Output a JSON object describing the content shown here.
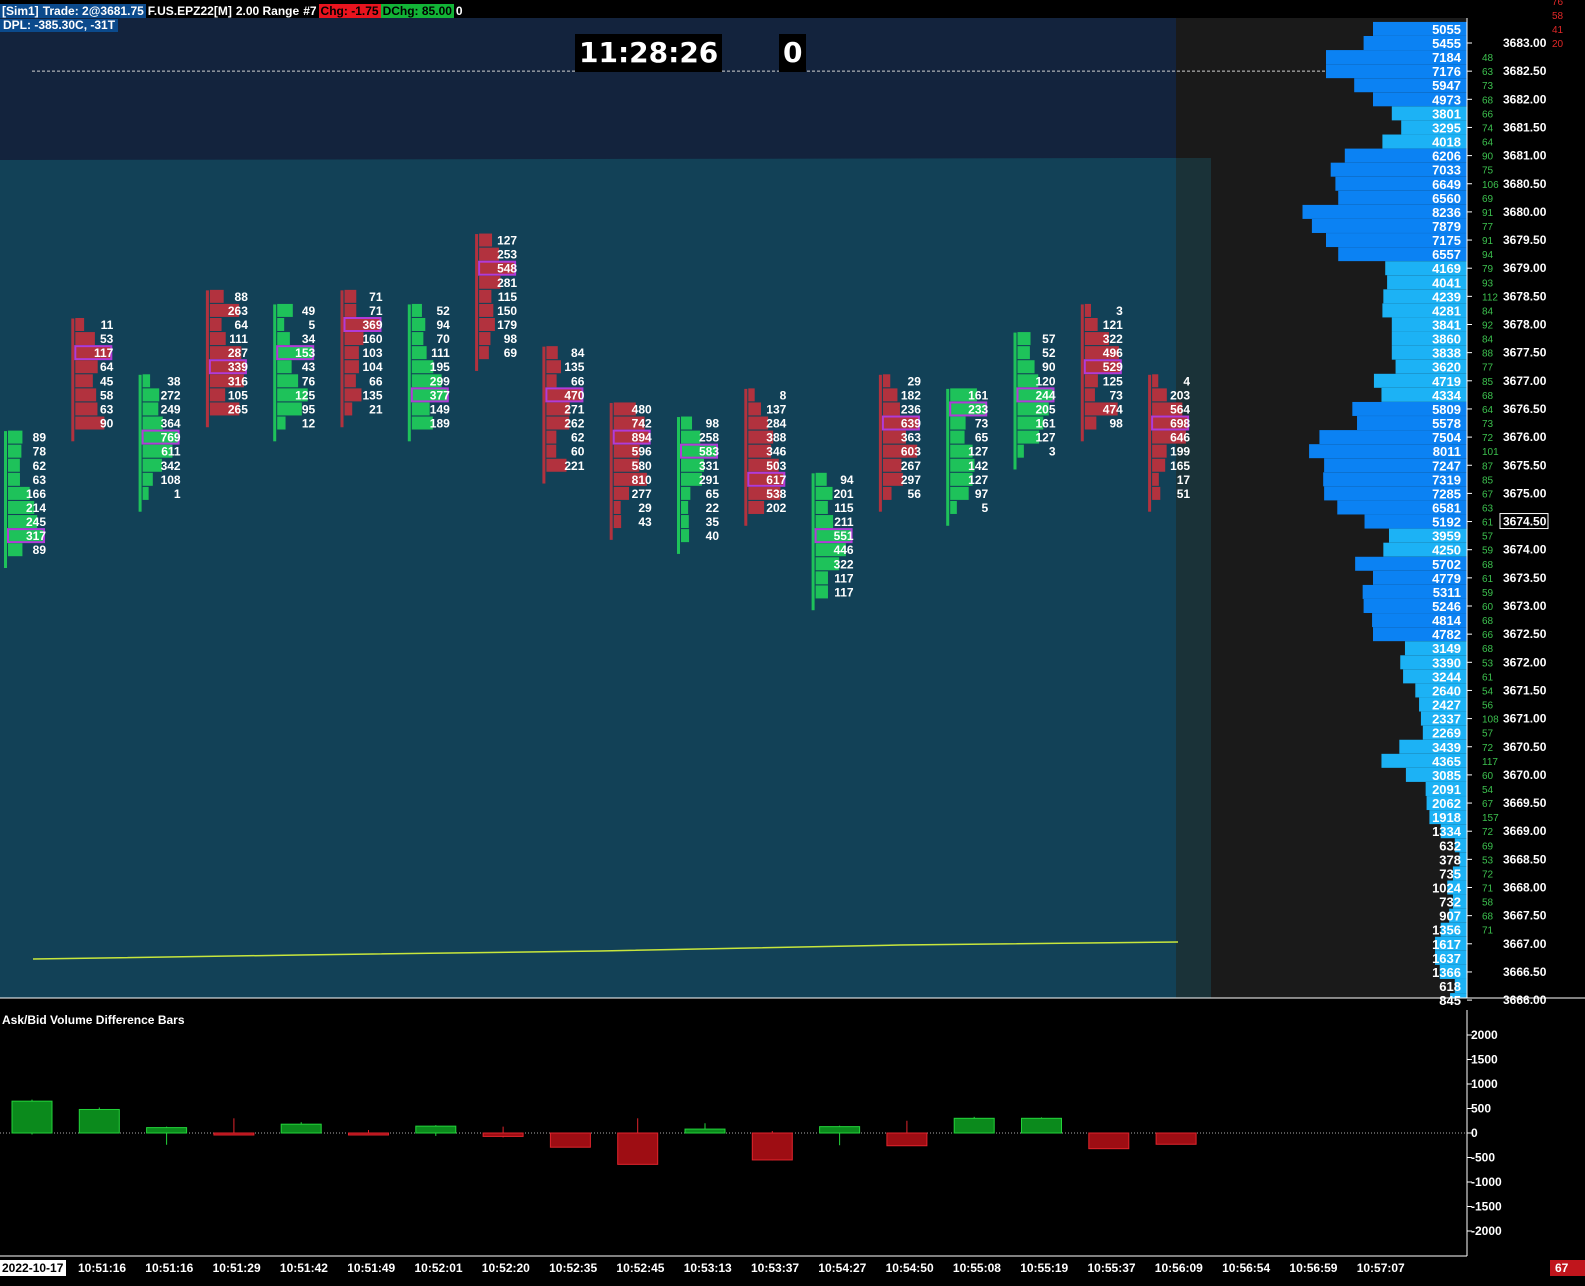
{
  "header": {
    "account": "[Sim1]",
    "trade": "Trade: 2@3681.75",
    "symbol": "F.US.EPZ22[M]",
    "bar_type": "2.00 Range",
    "bar_num": "#7",
    "chg": "Chg: -1.75",
    "dchg": "DChg: 85.00",
    "extra": "0",
    "dpl": "DPL: -385.30C, -31T"
  },
  "clock": {
    "time": "11:28:26",
    "counter": "0"
  },
  "colors": {
    "ask_green": "#1ec25a",
    "bid_red": "#b2323e",
    "poc_outline": "#b13bd8",
    "profile_blue": "#0b82f3",
    "profile_light": "#1cb2f5",
    "vwap": "#c8e63c",
    "bg_upper": "#13233d",
    "bg_lower": "#124157"
  },
  "price_axis": {
    "labels": [
      "3683.00",
      "3682.50",
      "3682.00",
      "3681.50",
      "3681.00",
      "3680.50",
      "3680.00",
      "3679.50",
      "3679.00",
      "3678.50",
      "3678.00",
      "3677.50",
      "3677.00",
      "3676.50",
      "3676.00",
      "3675.50",
      "3675.00",
      "3674.50",
      "3674.00",
      "3673.50",
      "3673.00",
      "3672.50",
      "3672.00",
      "3671.50",
      "3671.00",
      "3670.50",
      "3670.00",
      "3669.50",
      "3669.00",
      "3668.50",
      "3668.00",
      "3667.50",
      "3667.00",
      "3666.50",
      "3666.00"
    ],
    "current": "3674.50"
  },
  "right_small": [
    "76",
    "58",
    "41",
    "20",
    "48",
    "63",
    "73",
    "68",
    "66",
    "74",
    "64",
    "90",
    "75",
    "106",
    "69",
    "91",
    "77",
    "91",
    "94",
    "79",
    "93",
    "112",
    "84",
    "92",
    "84",
    "88",
    "77",
    "85",
    "68",
    "64",
    "73",
    "72",
    "101",
    "87",
    "85",
    "67",
    "63",
    "61",
    "57",
    "59",
    "68",
    "61",
    "59",
    "60",
    "68",
    "66",
    "68",
    "53",
    "61",
    "54",
    "56",
    "108",
    "57",
    "72",
    "117",
    "60",
    "54",
    "67",
    "157",
    "72",
    "69",
    "53",
    "72",
    "71",
    "58",
    "68",
    "71"
  ],
  "profile": [
    {
      "p": 3683.25,
      "v": "5055",
      "w": 1.0
    },
    {
      "p": 3683.0,
      "v": "5455",
      "w": 1.1
    },
    {
      "p": 3682.75,
      "v": "7184",
      "w": 1.5
    },
    {
      "p": 3682.5,
      "v": "7176",
      "w": 1.5
    },
    {
      "p": 3682.25,
      "v": "5947",
      "w": 1.2
    },
    {
      "p": 3682.0,
      "v": "4973",
      "w": 1.0
    },
    {
      "p": 3681.75,
      "v": "3801",
      "w": 0.8
    },
    {
      "p": 3681.5,
      "v": "3295",
      "w": 0.7
    },
    {
      "p": 3681.25,
      "v": "4018",
      "w": 0.9
    },
    {
      "p": 3681.0,
      "v": "6206",
      "w": 1.3
    },
    {
      "p": 3680.75,
      "v": "7033",
      "w": 1.45
    },
    {
      "p": 3680.5,
      "v": "6649",
      "w": 1.4
    },
    {
      "p": 3680.25,
      "v": "6560",
      "w": 1.37
    },
    {
      "p": 3680.0,
      "v": "8236",
      "w": 1.75
    },
    {
      "p": 3679.75,
      "v": "7879",
      "w": 1.65
    },
    {
      "p": 3679.5,
      "v": "7175",
      "w": 1.5
    },
    {
      "p": 3679.25,
      "v": "6557",
      "w": 1.37
    },
    {
      "p": 3679.0,
      "v": "4169",
      "w": 0.87
    },
    {
      "p": 3678.75,
      "v": "4041",
      "w": 0.85
    },
    {
      "p": 3678.5,
      "v": "4239",
      "w": 0.89
    },
    {
      "p": 3678.25,
      "v": "4281",
      "w": 0.9
    },
    {
      "p": 3678.0,
      "v": "3841",
      "w": 0.8
    },
    {
      "p": 3677.75,
      "v": "3860",
      "w": 0.8
    },
    {
      "p": 3677.5,
      "v": "3838",
      "w": 0.8
    },
    {
      "p": 3677.25,
      "v": "3620",
      "w": 0.76
    },
    {
      "p": 3677.0,
      "v": "4719",
      "w": 0.99
    },
    {
      "p": 3676.75,
      "v": "4334",
      "w": 0.91
    },
    {
      "p": 3676.5,
      "v": "5809",
      "w": 1.22
    },
    {
      "p": 3676.25,
      "v": "5578",
      "w": 1.17
    },
    {
      "p": 3676.0,
      "v": "7504",
      "w": 1.57
    },
    {
      "p": 3675.75,
      "v": "8011",
      "w": 1.68
    },
    {
      "p": 3675.5,
      "v": "7247",
      "w": 1.52
    },
    {
      "p": 3675.25,
      "v": "7319",
      "w": 1.53
    },
    {
      "p": 3675.0,
      "v": "7285",
      "w": 1.52
    },
    {
      "p": 3674.75,
      "v": "6581",
      "w": 1.38
    },
    {
      "p": 3674.5,
      "v": "5192",
      "w": 1.09
    },
    {
      "p": 3674.25,
      "v": "3959",
      "w": 0.83
    },
    {
      "p": 3674.0,
      "v": "4250",
      "w": 0.89
    },
    {
      "p": 3673.75,
      "v": "5702",
      "w": 1.19
    },
    {
      "p": 3673.5,
      "v": "4779",
      "w": 1.0
    },
    {
      "p": 3673.25,
      "v": "5311",
      "w": 1.11
    },
    {
      "p": 3673.0,
      "v": "5246",
      "w": 1.1
    },
    {
      "p": 3672.75,
      "v": "4814",
      "w": 1.01
    },
    {
      "p": 3672.5,
      "v": "4782",
      "w": 1.0
    },
    {
      "p": 3672.25,
      "v": "3149",
      "w": 0.66
    },
    {
      "p": 3672.0,
      "v": "3390",
      "w": 0.71
    },
    {
      "p": 3671.75,
      "v": "3244",
      "w": 0.68
    },
    {
      "p": 3671.5,
      "v": "2640",
      "w": 0.55
    },
    {
      "p": 3671.25,
      "v": "2427",
      "w": 0.51
    },
    {
      "p": 3671.0,
      "v": "2337",
      "w": 0.49
    },
    {
      "p": 3670.75,
      "v": "2269",
      "w": 0.47
    },
    {
      "p": 3670.5,
      "v": "3439",
      "w": 0.72
    },
    {
      "p": 3670.25,
      "v": "4365",
      "w": 0.91
    },
    {
      "p": 3670.0,
      "v": "3085",
      "w": 0.65
    },
    {
      "p": 3669.75,
      "v": "2091",
      "w": 0.44
    },
    {
      "p": 3669.5,
      "v": "2062",
      "w": 0.43
    },
    {
      "p": 3669.25,
      "v": "1918",
      "w": 0.4
    },
    {
      "p": 3669.0,
      "v": "1334",
      "w": 0.28
    },
    {
      "p": 3668.75,
      "v": "632",
      "w": 0.13
    },
    {
      "p": 3668.5,
      "v": "378",
      "w": 0.08
    },
    {
      "p": 3668.25,
      "v": "735",
      "w": 0.15
    },
    {
      "p": 3668.0,
      "v": "1024",
      "w": 0.21
    },
    {
      "p": 3667.75,
      "v": "732",
      "w": 0.15
    },
    {
      "p": 3667.5,
      "v": "907",
      "w": 0.19
    },
    {
      "p": 3667.25,
      "v": "1356",
      "w": 0.28
    },
    {
      "p": 3667.0,
      "v": "1617",
      "w": 0.34
    },
    {
      "p": 3666.75,
      "v": "1637",
      "w": 0.34
    },
    {
      "p": 3666.5,
      "v": "1366",
      "w": 0.29
    },
    {
      "p": 3666.25,
      "v": "618",
      "w": 0.13
    },
    {
      "p": 3666.0,
      "v": "845",
      "w": 0.18
    }
  ],
  "footprint": [
    {
      "c": "g",
      "top": 3676.0,
      "vals": [
        "89",
        "78",
        "62",
        "63",
        "166",
        "214",
        "245",
        "317",
        "89"
      ],
      "poc": 7
    },
    {
      "c": "r",
      "top": 3678.0,
      "vals": [
        "11",
        "53",
        "117",
        "64",
        "45",
        "58",
        "63",
        "90"
      ],
      "poc": 2
    },
    {
      "c": "g",
      "top": 3677.0,
      "vals": [
        "38",
        "272",
        "249",
        "364",
        "769",
        "611",
        "342",
        "108",
        "1"
      ],
      "poc": 4
    },
    {
      "c": "r",
      "top": 3678.5,
      "vals": [
        "88",
        "263",
        "64",
        "111",
        "287",
        "339",
        "316",
        "105",
        "265"
      ],
      "poc": 5
    },
    {
      "c": "g",
      "top": 3678.25,
      "vals": [
        "49",
        "5",
        "34",
        "153",
        "43",
        "76",
        "125",
        "95",
        "12"
      ],
      "poc": 3
    },
    {
      "c": "r",
      "top": 3678.5,
      "vals": [
        "71",
        "71",
        "369",
        "160",
        "103",
        "104",
        "66",
        "135",
        "21"
      ],
      "poc": 2
    },
    {
      "c": "g",
      "top": 3678.25,
      "vals": [
        "52",
        "94",
        "70",
        "111",
        "195",
        "299",
        "377",
        "149",
        "189"
      ],
      "poc": 6
    },
    {
      "c": "r",
      "top": 3679.5,
      "vals": [
        "127",
        "253",
        "548",
        "281",
        "115",
        "150",
        "179",
        "98",
        "69"
      ],
      "poc": 2
    },
    {
      "c": "r",
      "top": 3677.5,
      "vals": [
        "84",
        "135",
        "66",
        "470",
        "271",
        "262",
        "62",
        "60",
        "221"
      ],
      "poc": 3
    },
    {
      "c": "r",
      "top": 3676.5,
      "vals": [
        "480",
        "742",
        "894",
        "596",
        "580",
        "810",
        "277",
        "29",
        "43"
      ],
      "poc": 2
    },
    {
      "c": "g",
      "top": 3676.25,
      "vals": [
        "98",
        "258",
        "583",
        "331",
        "291",
        "65",
        "22",
        "35",
        "40"
      ],
      "poc": 2
    },
    {
      "c": "r",
      "top": 3676.75,
      "vals": [
        "8",
        "137",
        "284",
        "388",
        "346",
        "503",
        "617",
        "538",
        "202"
      ],
      "poc": 6
    },
    {
      "c": "g",
      "top": 3675.25,
      "vals": [
        "94",
        "201",
        "115",
        "211",
        "551",
        "446",
        "322",
        "117",
        "117"
      ],
      "poc": 4
    },
    {
      "c": "r",
      "top": 3677.0,
      "vals": [
        "29",
        "182",
        "236",
        "639",
        "363",
        "603",
        "267",
        "297",
        "56"
      ],
      "poc": 3
    },
    {
      "c": "g",
      "top": 3676.75,
      "vals": [
        "161",
        "233",
        "73",
        "65",
        "127",
        "142",
        "127",
        "97",
        "5"
      ],
      "poc": 1
    },
    {
      "c": "g",
      "top": 3677.75,
      "vals": [
        "57",
        "52",
        "90",
        "120",
        "244",
        "205",
        "161",
        "127",
        "3"
      ],
      "poc": 4
    },
    {
      "c": "r",
      "top": 3678.25,
      "vals": [
        "3",
        "121",
        "322",
        "496",
        "529",
        "125",
        "73",
        "474",
        "98"
      ],
      "poc": 4
    },
    {
      "c": "r",
      "top": 3677.0,
      "vals": [
        "4",
        "203",
        "564",
        "698",
        "646",
        "199",
        "165",
        "17",
        "51"
      ],
      "poc": 3
    }
  ],
  "diff_panel": {
    "title": "Ask/Bid Volume Difference Bars",
    "y_labels": [
      "2000",
      "1500",
      "1000",
      "500",
      "0",
      "-500",
      "-1000",
      "-1500",
      "-2000"
    ],
    "bars": [
      {
        "o": 0,
        "c": 650,
        "h": 680,
        "l": -30
      },
      {
        "o": 0,
        "c": 480,
        "h": 520,
        "l": 0
      },
      {
        "o": 0,
        "c": 110,
        "h": 130,
        "l": -240
      },
      {
        "o": 0,
        "c": -20,
        "h": 300,
        "l": -20
      },
      {
        "o": 0,
        "c": 180,
        "h": 220,
        "l": 0
      },
      {
        "o": 0,
        "c": -15,
        "h": 60,
        "l": -15
      },
      {
        "o": 0,
        "c": 140,
        "h": 160,
        "l": -60
      },
      {
        "o": 0,
        "c": -70,
        "h": 130,
        "l": -90
      },
      {
        "o": 0,
        "c": -290,
        "h": 0,
        "l": -290
      },
      {
        "o": 0,
        "c": -640,
        "h": 300,
        "l": -640
      },
      {
        "o": 0,
        "c": 80,
        "h": 200,
        "l": 0
      },
      {
        "o": 0,
        "c": -550,
        "h": 40,
        "l": -560
      },
      {
        "o": 0,
        "c": 130,
        "h": 150,
        "l": -250
      },
      {
        "o": 0,
        "c": -260,
        "h": 250,
        "l": -260
      },
      {
        "o": 0,
        "c": 300,
        "h": 330,
        "l": 0
      },
      {
        "o": 0,
        "c": 300,
        "h": 320,
        "l": 0
      },
      {
        "o": 0,
        "c": -320,
        "h": 0,
        "l": -320
      },
      {
        "o": 0,
        "c": -230,
        "h": 0,
        "l": -230
      }
    ],
    "x_labels": [
      "2022-10-17",
      "10:51:16",
      "10:51:16",
      "10:51:29",
      "10:51:42",
      "10:51:49",
      "10:52:01",
      "10:52:20",
      "10:52:35",
      "10:52:45",
      "10:53:13",
      "10:53:37",
      "10:54:27",
      "10:54:50",
      "10:55:08",
      "10:55:19",
      "10:55:37",
      "10:56:09",
      "10:56:54",
      "10:56:59",
      "10:57:07"
    ],
    "corner": "67"
  }
}
